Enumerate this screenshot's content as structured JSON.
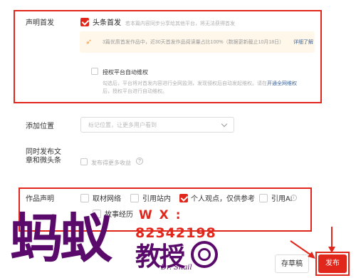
{
  "declaration_first": {
    "label": "声明首发",
    "option_label": "头条首发",
    "option_desc": "若本篇内容同步分享给其他平台，将无法获得首发",
    "banner_text": "3篇优质首发作品中，近30天首发作品阅读量占比100%（数据更新截止10月18日）",
    "banner_link": "详细了解",
    "auth_label": "授权平台自动维权",
    "auth_desc": "勾选后，平台将对首发内容进行全网监测，发现侵权后自动发起维权。请在",
    "auth_link": "开通全网维权",
    "auth_desc2": "后，授权平台进行自动维权。"
  },
  "location": {
    "label": "添加位置",
    "placeholder": "标记位置，让更多用户看到"
  },
  "sync": {
    "label": "同时发布文章和微头条",
    "option_label": "发布得更多收益"
  },
  "work_statement": {
    "label": "作品声明",
    "options": [
      {
        "label": "取材网络",
        "checked": false
      },
      {
        "label": "引用站内",
        "checked": false
      },
      {
        "label": "个人观点，仅供参考",
        "checked": true
      },
      {
        "label": "引用AI",
        "checked": false
      },
      {
        "label": "故事经历",
        "checked": false
      }
    ]
  },
  "footer": {
    "draft_label": "存草稿",
    "publish_label": "发布"
  },
  "watermark": {
    "brand": "蚂蚁",
    "wx": "W X :",
    "wx_number": "82342198",
    "sub": "教授",
    "sub2": "Dr. Snail"
  },
  "colors": {
    "accent": "#e1261c",
    "banner": "#fff7ea",
    "watermark": "#5a0a6a"
  }
}
